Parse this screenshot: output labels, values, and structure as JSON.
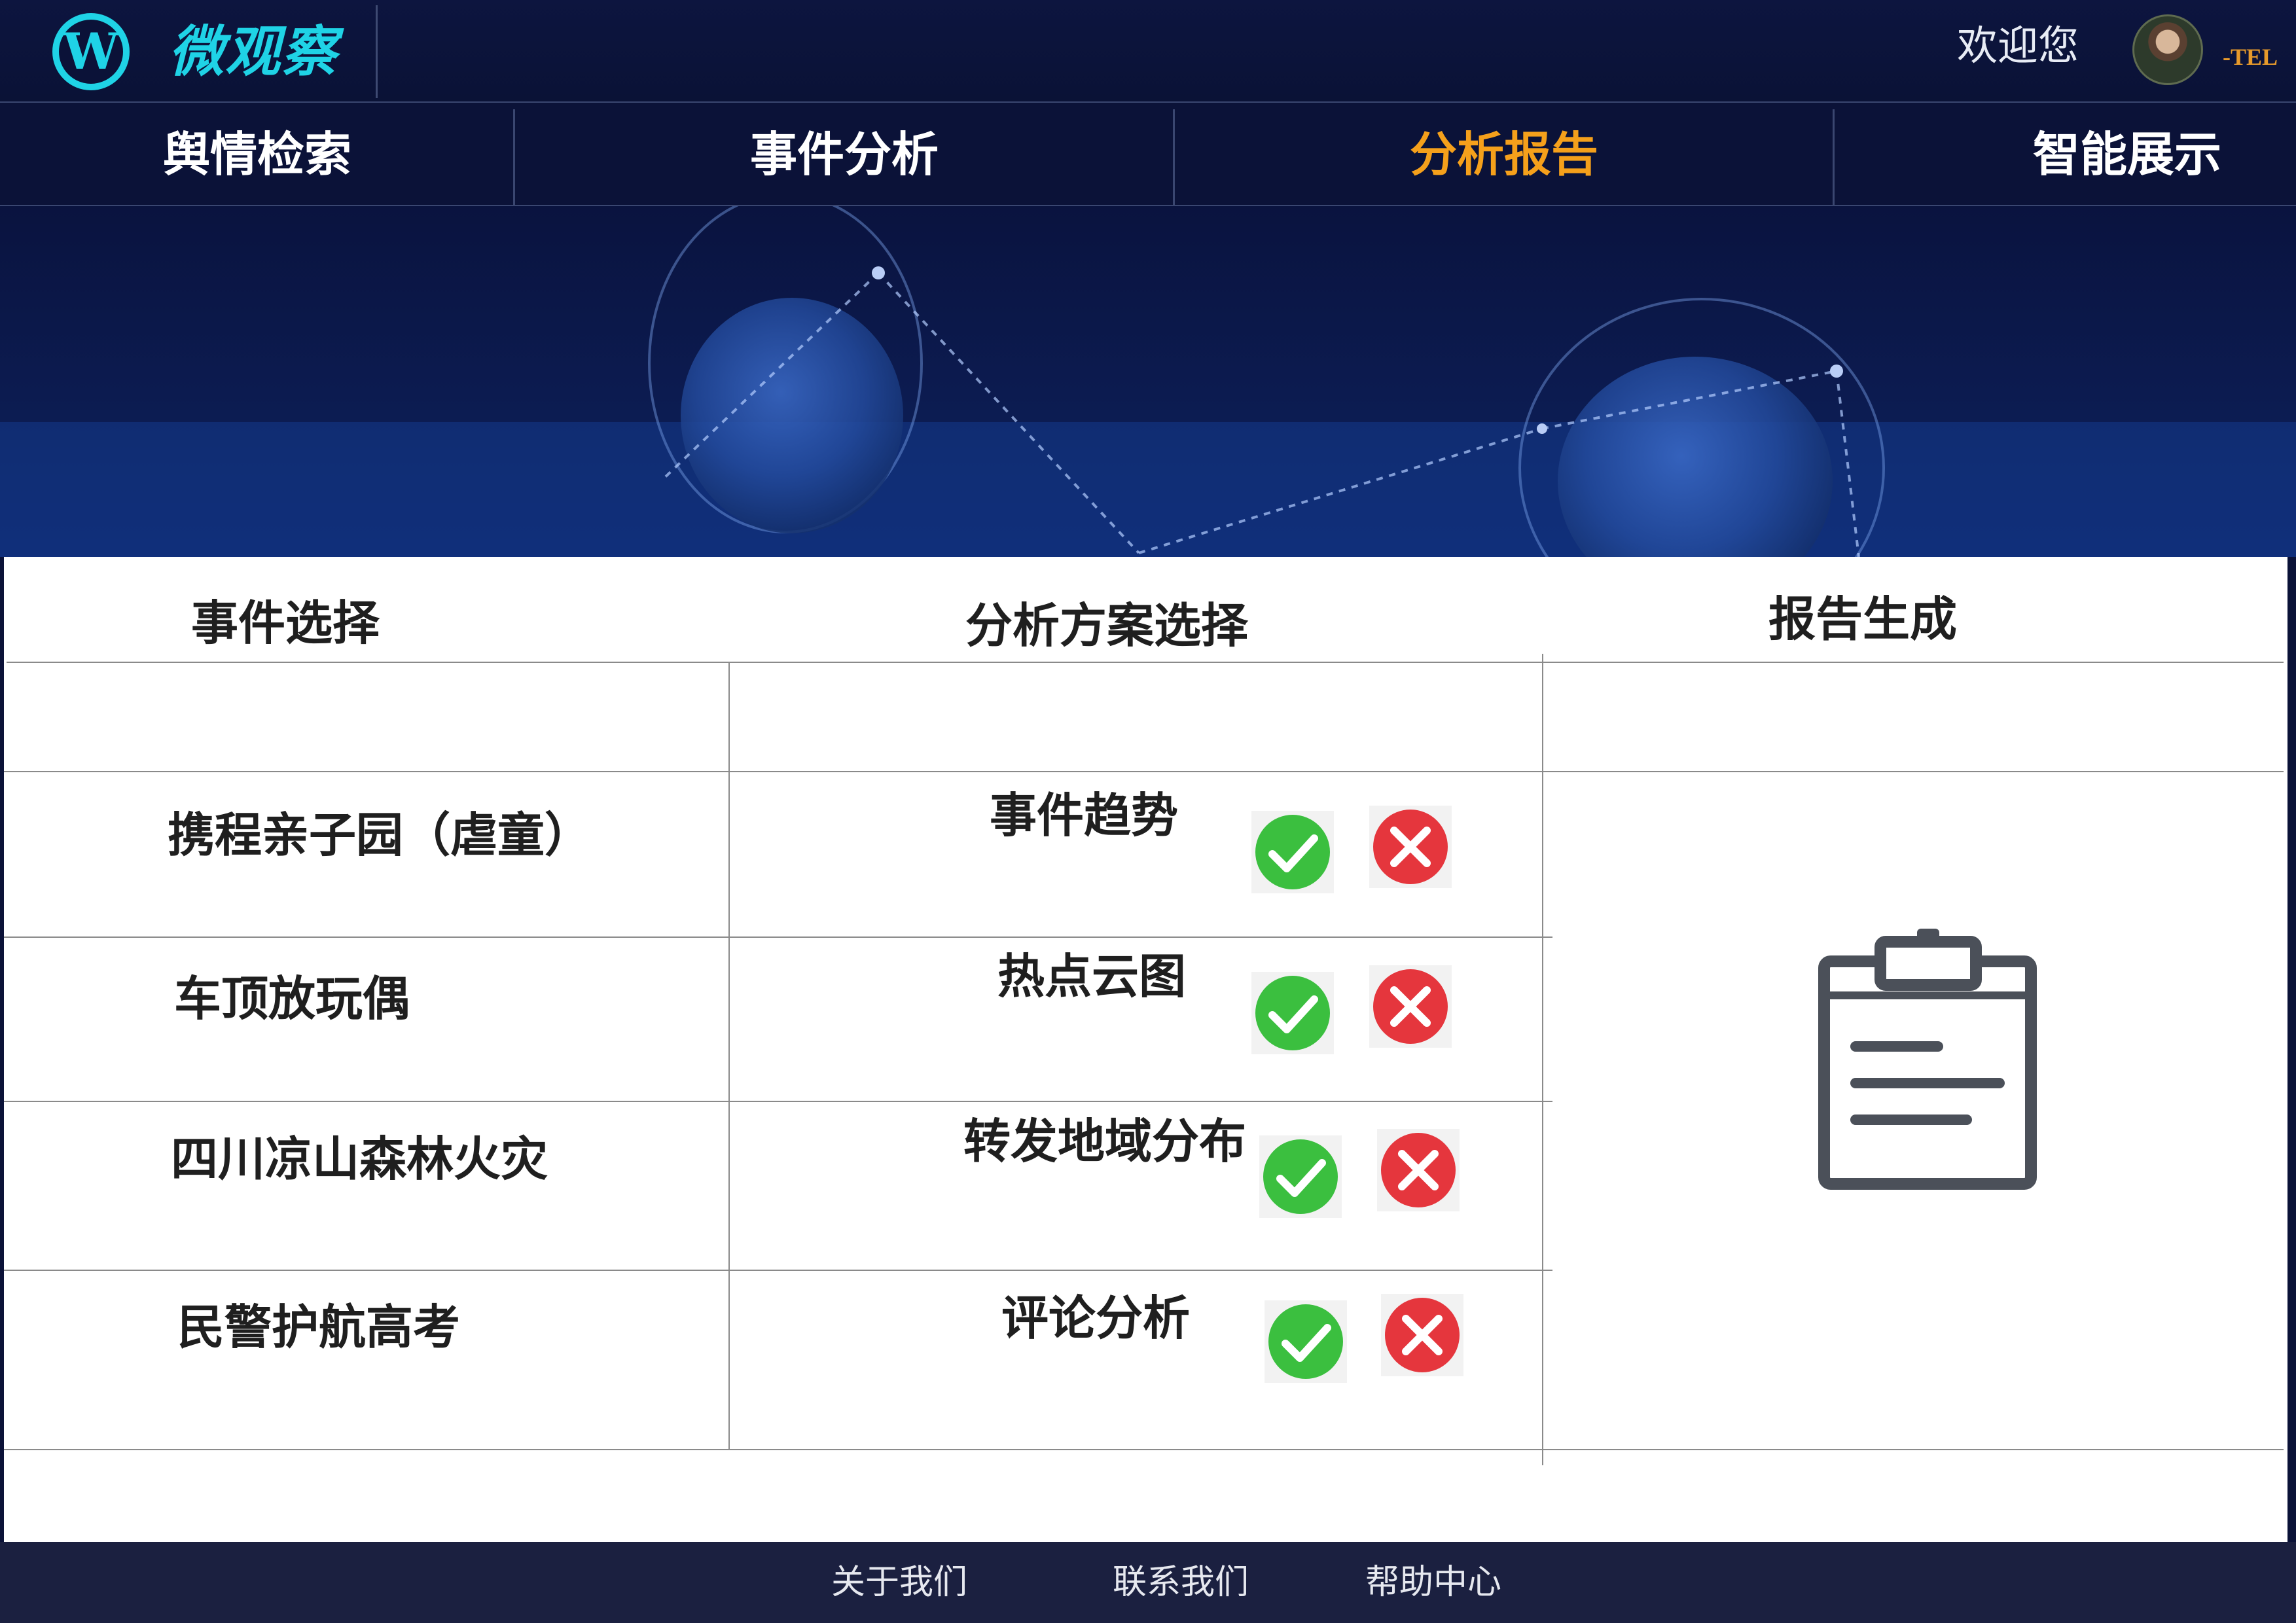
{
  "header": {
    "logo_letter": "W",
    "app_title": "微观察",
    "welcome": "欢迎您",
    "user_tag": "-TEL"
  },
  "nav": {
    "items": [
      {
        "label": "舆情检索"
      },
      {
        "label": "事件分析"
      },
      {
        "label": "分析报告",
        "active": true
      },
      {
        "label": "智能展示"
      }
    ]
  },
  "table": {
    "headers": {
      "events": "事件选择",
      "plans": "分析方案选择",
      "report": "报告生成"
    },
    "events": [
      "携程亲子园（虐童）",
      "车顶放玩偶",
      "四川凉山森林火灾",
      "民警护航高考"
    ],
    "plans": [
      "事件趋势",
      "热点云图",
      "转发地域分布",
      "评论分析"
    ]
  },
  "footer": {
    "links": [
      "关于我们",
      "联系我们",
      "帮助中心"
    ]
  },
  "colors": {
    "accent_cyan": "#1fd3e6",
    "active_nav": "#f5a01b",
    "confirm_green": "#3bbf3f",
    "cancel_red": "#e5363d"
  }
}
